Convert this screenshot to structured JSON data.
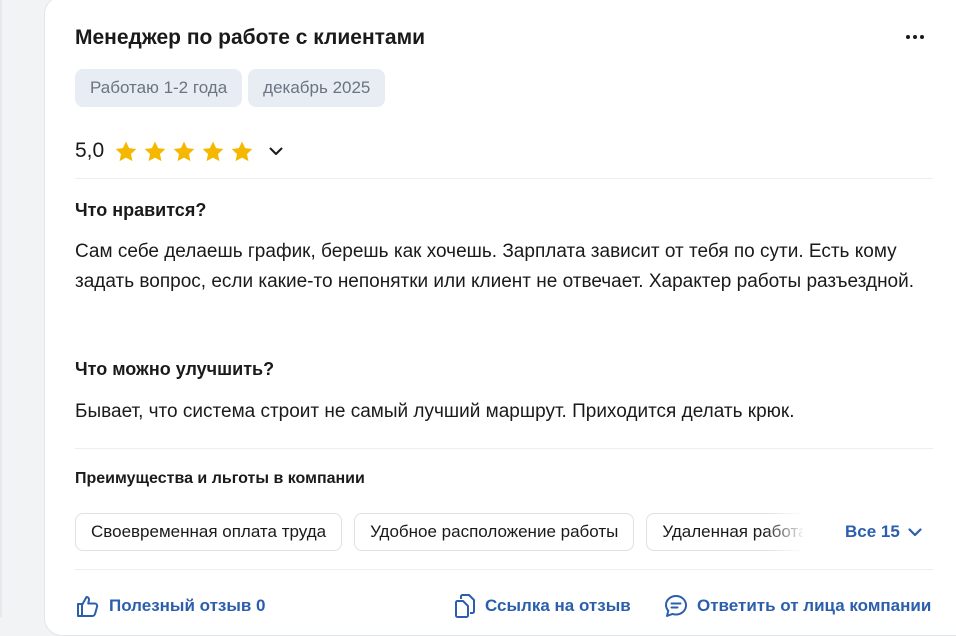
{
  "review": {
    "title": "Менеджер по работе с клиентами",
    "tags": [
      "Работаю 1-2 года",
      "декабрь 2025"
    ],
    "rating": {
      "value_text": "5,0",
      "value": 5,
      "max": 5,
      "star_color": "#f5b800"
    },
    "likes": {
      "title": "Что нравится?",
      "text": "Сам себе делаешь график, берешь как хочешь. Зарплата зависит от тебя по сути. Есть кому задать вопрос, если какие-то непонятки или клиент не отвечает. Характер работы разъездной."
    },
    "improve": {
      "title": "Что можно улучшить?",
      "text": "Бывает, что система строит не самый лучший маршрут. Приходится делать крюк."
    },
    "benefits": {
      "title": "Преимущества и льготы в компании",
      "chips": [
        "Своевременная оплата труда",
        "Удобное расположение работы",
        "Удаленная работа"
      ],
      "all_label": "Все 15"
    },
    "actions": {
      "helpful_label": "Полезный отзыв 0",
      "link_label": "Ссылка на отзыв",
      "reply_label": "Ответить от лица компании"
    }
  },
  "colors": {
    "accent": "#2b5fac",
    "tag_bg": "#e8ecf3",
    "tag_text": "#6b7480"
  },
  "icons": {
    "more": "more-dots-icon",
    "chevron": "chevron-down-icon",
    "thumbs_up": "thumbs-up-icon",
    "copy_link": "copy-icon",
    "reply": "chat-bubble-icon"
  }
}
